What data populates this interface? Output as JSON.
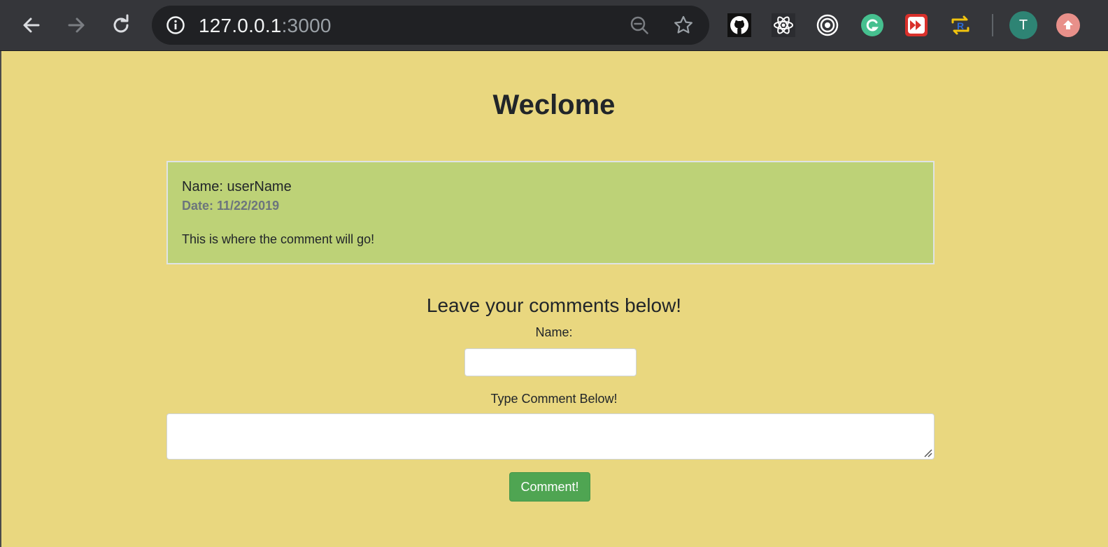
{
  "browser": {
    "url_host": "127.0.0.1",
    "url_port": ":3000",
    "profile_initial": "T",
    "icons": [
      "back-icon",
      "forward-icon",
      "reload-icon",
      "info-icon",
      "zoom-out-icon",
      "star-icon",
      "github-icon",
      "react-icon",
      "target-icon",
      "grammarly-icon",
      "fast-forward-icon",
      "redux-icon",
      "update-icon"
    ]
  },
  "page": {
    "title": "Weclome",
    "comment_card": {
      "name": "Name: userName",
      "date": "Date: 11/22/2019",
      "text": "This is where the comment will go!"
    },
    "form": {
      "heading": "Leave your comments below!",
      "name_label": "Name:",
      "name_value": "",
      "comment_label": "Type Comment Below!",
      "comment_value": "",
      "submit_label": "Comment!"
    }
  },
  "colors": {
    "page_background": "#e9d77f",
    "card_background": "#bdd277",
    "button": "#4fa552"
  }
}
